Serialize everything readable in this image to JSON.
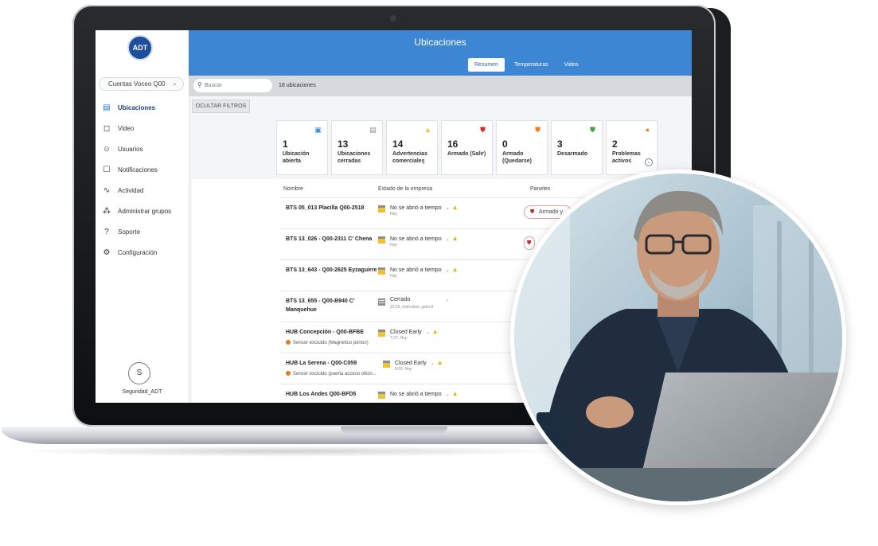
{
  "app": {
    "logo_text": "ADT",
    "page_title": "Ubicaciones",
    "tabs": [
      {
        "label": "Resumen",
        "active": true
      },
      {
        "label": "Temperaturas",
        "active": false
      },
      {
        "label": "Video",
        "active": false
      }
    ]
  },
  "sidebar": {
    "account": "Cuentas Voceo Q00",
    "items": [
      {
        "label": "Ubicaciones",
        "icon": "store-icon",
        "active": true
      },
      {
        "label": "Video",
        "icon": "camera-icon",
        "active": false
      },
      {
        "label": "Usuarios",
        "icon": "users-icon",
        "active": false
      },
      {
        "label": "Notificaciones",
        "icon": "bell-icon",
        "active": false
      },
      {
        "label": "Actividad",
        "icon": "activity-icon",
        "active": false
      },
      {
        "label": "Administrar grupos",
        "icon": "groups-icon",
        "active": false
      },
      {
        "label": "Soporte",
        "icon": "headset-icon",
        "active": false
      },
      {
        "label": "Configuración",
        "icon": "gear-icon",
        "active": false
      }
    ],
    "user_initial": "S",
    "user_name": "Seguridad_ADT"
  },
  "search": {
    "placeholder": "Buscar",
    "count": "18 ubicaciones"
  },
  "filters_button": "OCULTAR FILTROS",
  "summary_cards": [
    {
      "num": "1",
      "label": "Ubicación abierta",
      "icon": "store-open-icon",
      "color": "#3c86d3"
    },
    {
      "num": "13",
      "label": "Ubicaciones cerradas",
      "icon": "store-closed-icon",
      "color": "#8a8d93"
    },
    {
      "num": "14",
      "label": "Advertencias comerciales",
      "icon": "warning-icon",
      "color": "#f2c12e"
    },
    {
      "num": "16",
      "label": "Armado (Salir)",
      "icon": "shield-armed-away-icon",
      "color": "#d32f2f"
    },
    {
      "num": "0",
      "label": "Armado (Quedarse)",
      "icon": "shield-armed-stay-icon",
      "color": "#ef7d2a"
    },
    {
      "num": "3",
      "label": "Desarmado",
      "icon": "shield-disarmed-icon",
      "color": "#43a047"
    },
    {
      "num": "2",
      "label": "Problemas activos",
      "icon": "alert-icon",
      "color": "#ef7d2a"
    }
  ],
  "table": {
    "headers": {
      "name": "Nombre",
      "status": "Estado de la empresa",
      "panels": "Paneles"
    },
    "rows": [
      {
        "name": "BTS 05_013 Placilla Q00-2518",
        "warning": "",
        "status": "No se abrió a tiempo",
        "sub": "Hoy",
        "warn_icon": true,
        "panel": "Armado y"
      },
      {
        "name": "BTS 13_026 - Q00-2311 C' Chena",
        "warning": "",
        "status": "No se abrió a tiempo",
        "sub": "Hoy",
        "warn_icon": true,
        "panel": ""
      },
      {
        "name": "BTS 13_643 - Q00-2625 Eyzaguirre",
        "warning": "",
        "status": "No se abrió a tiempo",
        "sub": "Hoy",
        "warn_icon": true,
        "panel": ""
      },
      {
        "name": "BTS 13_655 - Q00-B940 C' Manquehue",
        "warning": "",
        "status": "Cerrado",
        "sub": "23:16, miércoles, junio 8",
        "warn_icon": false,
        "panel": ""
      },
      {
        "name": "HUB Concepción - Q00-BFBE",
        "warning": "Sensor excluido (Magnetico porton)",
        "status": "Closed Early",
        "sub": "7:27, Hoy",
        "warn_icon": true,
        "panel": ""
      },
      {
        "name": "HUB La Serena - Q00-C059",
        "warning": "Sensor excluido (puerta acceso oficin...",
        "status": "Closed Early",
        "sub": "8:03, Hoy",
        "warn_icon": true,
        "panel": ""
      },
      {
        "name": "HUB Los Andes Q00-BFD5",
        "warning": "",
        "status": "No se abrió a tiempo",
        "sub": "",
        "warn_icon": true,
        "panel": ""
      }
    ]
  }
}
